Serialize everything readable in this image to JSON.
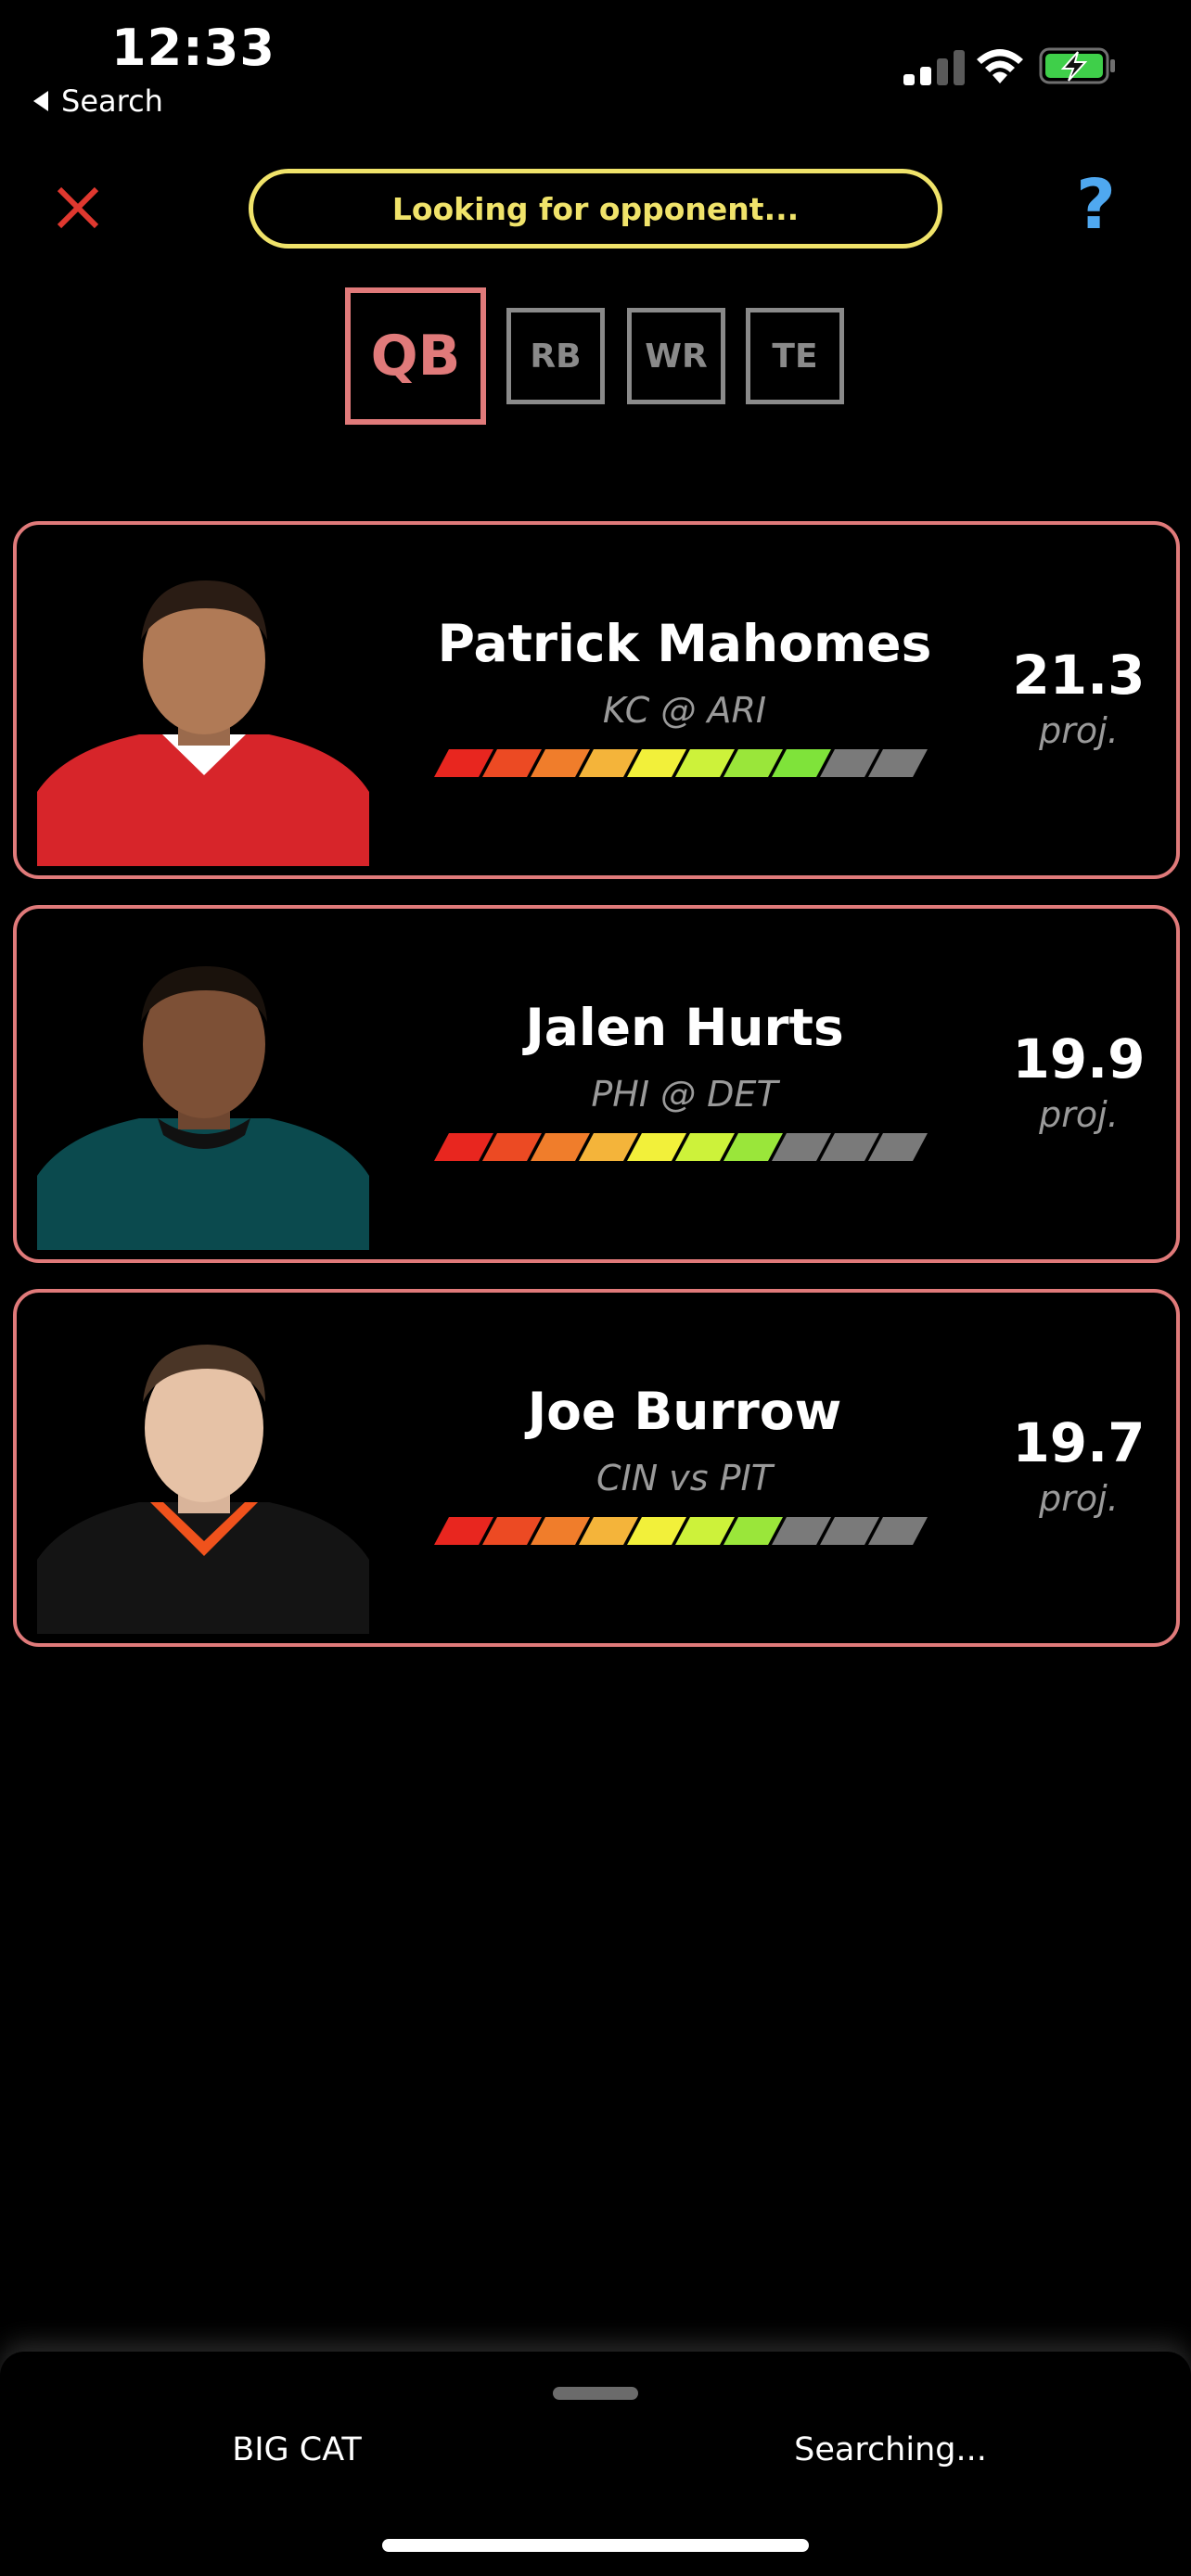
{
  "status_bar": {
    "time": "12:33",
    "back_label": "Search"
  },
  "header": {
    "status_text": "Looking for opponent...",
    "help_label": "?"
  },
  "positions": [
    {
      "label": "QB",
      "active": true
    },
    {
      "label": "RB",
      "active": false
    },
    {
      "label": "WR",
      "active": false
    },
    {
      "label": "TE",
      "active": false
    }
  ],
  "meter_colors": [
    "#e8261f",
    "#ec4a23",
    "#f07d2b",
    "#f4b43a",
    "#f2f03a",
    "#cdf23a",
    "#9ae63a",
    "#7fe33a",
    "#7a7a7a",
    "#7a7a7a"
  ],
  "meter_inactive_color": "#7a7a7a",
  "players": [
    {
      "name": "Patrick Mahomes",
      "matchup": "KC @ ARI",
      "projection": "21.3",
      "proj_label": "proj.",
      "rating": 8,
      "jersey_color": "#d7252a",
      "collar_color": "#ffffff"
    },
    {
      "name": "Jalen Hurts",
      "matchup": "PHI @ DET",
      "projection": "19.9",
      "proj_label": "proj.",
      "rating": 7,
      "jersey_color": "#0b4a4e",
      "collar_color": "#111111"
    },
    {
      "name": "Joe Burrow",
      "matchup": "CIN vs PIT",
      "projection": "19.7",
      "proj_label": "proj.",
      "rating": 7,
      "jersey_color": "#141414",
      "collar_color": "#f0521c"
    }
  ],
  "bottom_bar": {
    "user_name": "BIG CAT",
    "opponent_status": "Searching..."
  }
}
